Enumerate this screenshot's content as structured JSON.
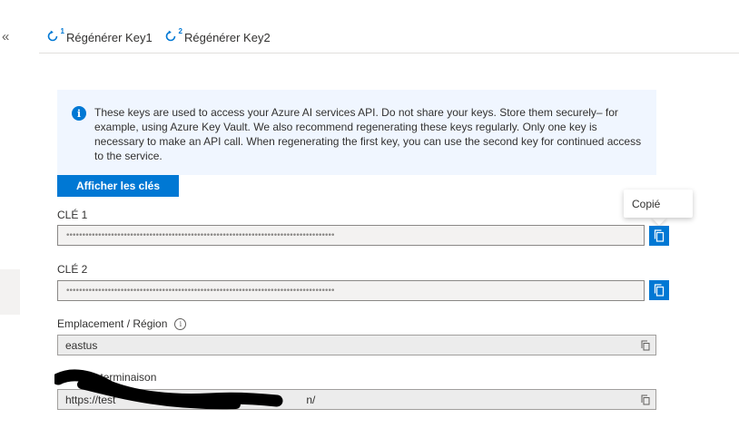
{
  "sidebar": {
    "collapse_label": "«"
  },
  "toolbar": {
    "regenerate_key1": {
      "label": "Régénérer Key1",
      "icon": "refresh-icon",
      "badge": "1"
    },
    "regenerate_key2": {
      "label": "Régénérer Key2",
      "icon": "refresh-icon",
      "badge": "2"
    }
  },
  "info": {
    "icon": "info-icon",
    "text": "These keys are used to access your Azure AI services API. Do not share your keys. Store them securely– for example, using Azure Key Vault. We also recommend regenerating these keys regularly. Only one key is necessary to make an API call. When regenerating the first key, you can use the second key for continued access to the service."
  },
  "show_keys_button": "Afficher les clés",
  "tooltip": {
    "text": "Copié"
  },
  "key1": {
    "label": "CLÉ 1",
    "value": "••••••••••••••••••••••••••••••••••••••••••••••••••••••••••••••••••••••••••••••••••••"
  },
  "key2": {
    "label": "CLÉ 2",
    "value": "••••••••••••••••••••••••••••••••••••••••••••••••••••••••••••••••••••••••••••••••••••"
  },
  "location": {
    "label": "Emplacement / Région",
    "value": "eastus"
  },
  "endpoint": {
    "label": "Point de terminaison",
    "value_visible_start": "https://test",
    "value_visible_end": "n/"
  },
  "colors": {
    "accent": "#0078d4",
    "info_bg": "#f0f6ff",
    "field_bg": "#f3f2f1"
  }
}
